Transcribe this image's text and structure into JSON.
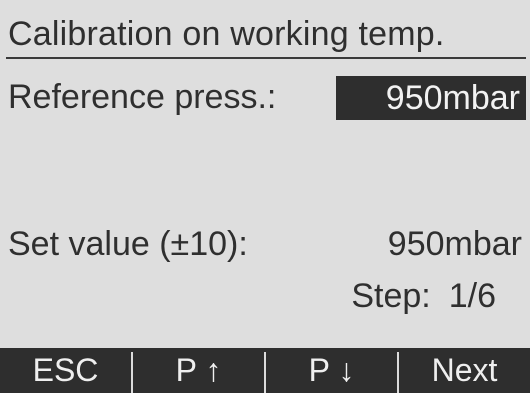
{
  "screen": {
    "title": "Calibration on working temp.",
    "reference": {
      "label": "Reference press.:",
      "value": "950mbar"
    },
    "set_value": {
      "label": "Set value (±10):",
      "value": "950mbar"
    },
    "step": {
      "label": "Step:",
      "value": "1/6"
    }
  },
  "softkeys": {
    "esc": "ESC",
    "p_up": "P ↑",
    "p_down": "P ↓",
    "next": "Next"
  },
  "colors": {
    "background": "#dedede",
    "text": "#2f2f2f",
    "highlight_bg": "#2e2e2e",
    "highlight_text": "#f2f2f2"
  }
}
